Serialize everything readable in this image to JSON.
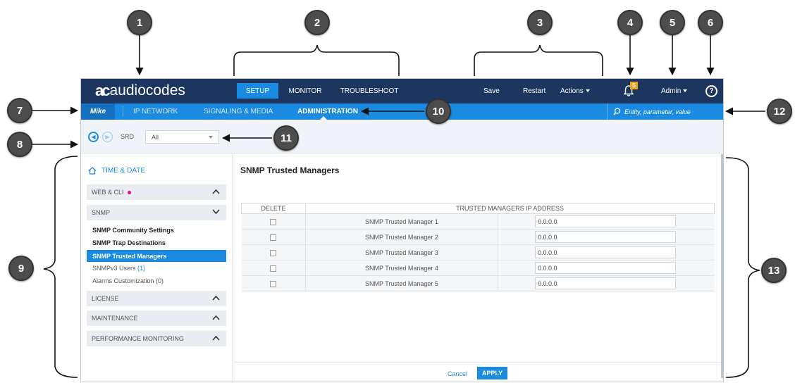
{
  "callouts": [
    "1",
    "2",
    "3",
    "4",
    "5",
    "6",
    "7",
    "8",
    "9",
    "10",
    "11",
    "12",
    "13"
  ],
  "header": {
    "logo_mark": "ac",
    "logo_text": "audiocodes",
    "tabs": [
      {
        "label": "SETUP",
        "active": true
      },
      {
        "label": "MONITOR",
        "active": false
      },
      {
        "label": "TROUBLESHOOT",
        "active": false
      }
    ],
    "actions": {
      "save": "Save",
      "restart": "Restart",
      "actions": "Actions"
    },
    "notification_count": "5",
    "user_menu": "Admin",
    "help_icon": "?"
  },
  "subnav": {
    "user": "Mike",
    "items": [
      {
        "label": "IP NETWORK",
        "active": false
      },
      {
        "label": "SIGNALING & MEDIA",
        "active": false
      },
      {
        "label": "ADMINISTRATION",
        "active": true
      }
    ],
    "search_placeholder": "Entity, parameter, value"
  },
  "toolbar": {
    "srd_label": "SRD",
    "srd_value": "All"
  },
  "sidebar": {
    "home": "TIME & DATE",
    "groups": {
      "web_cli": "WEB & CLI",
      "snmp": "SNMP",
      "license": "LICENSE",
      "maintenance": "MAINTENANCE",
      "performance": "PERFORMANCE MONITORING"
    },
    "snmp_items": [
      {
        "label": "SNMP Community Settings"
      },
      {
        "label": "SNMP Trap Destinations"
      },
      {
        "label": "SNMP Trusted Managers",
        "selected": true
      },
      {
        "label": "SNMPv3 Users",
        "count": "(1)"
      },
      {
        "label": "Alarms Customization",
        "count": "(0)"
      }
    ]
  },
  "content": {
    "title": "SNMP Trusted Managers",
    "columns": [
      "DELETE",
      "TRUSTED MANAGERS IP ADDRESS"
    ],
    "rows": [
      {
        "name": "SNMP Trusted Manager 1",
        "ip": "0.0.0.0"
      },
      {
        "name": "SNMP Trusted Manager 2",
        "ip": "0.0.0.0"
      },
      {
        "name": "SNMP Trusted Manager 3",
        "ip": "0.0.0.0"
      },
      {
        "name": "SNMP Trusted Manager 4",
        "ip": "0.0.0.0"
      },
      {
        "name": "SNMP Trusted Manager 5",
        "ip": "0.0.0.0"
      }
    ],
    "cancel_label": "Cancel",
    "apply_label": "APPLY"
  },
  "colors": {
    "topbar": "#1d3660",
    "accent": "#1a8be0",
    "callout": "#4d4d4d",
    "notification": "#f3a21a",
    "dirty_dot": "#e0147a"
  }
}
